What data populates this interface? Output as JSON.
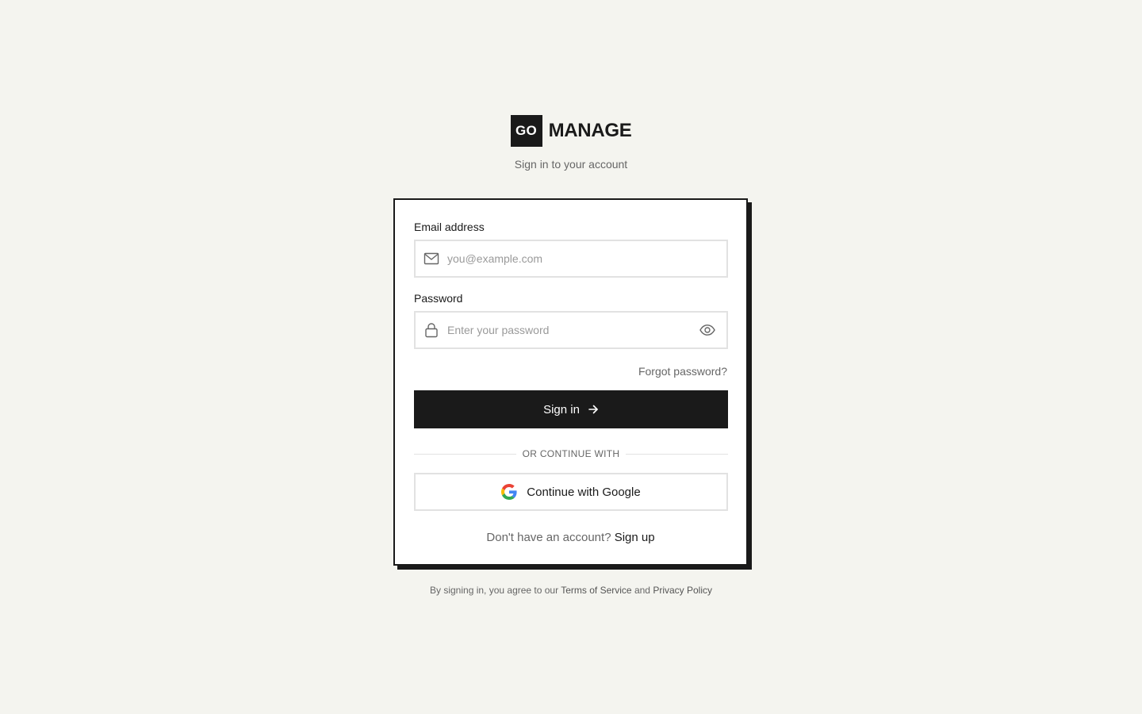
{
  "brand": {
    "logo_mark": "GO",
    "logo_text": "MANAGE",
    "subtitle": "Sign in to your account"
  },
  "form": {
    "email": {
      "label": "Email address",
      "placeholder": "you@example.com",
      "value": "",
      "icon": "mail-icon"
    },
    "password": {
      "label": "Password",
      "placeholder": "Enter your password",
      "value": "",
      "icon": "lock-icon",
      "toggle_icon": "eye-icon"
    },
    "forgot_label": "Forgot password?",
    "submit_label": "Sign in",
    "divider_label": "OR CONTINUE WITH",
    "google_label": "Continue with Google",
    "signup_prompt": "Don't have an account?",
    "signup_label": "Sign up"
  },
  "legal": {
    "prefix": "By signing in, you agree to our",
    "terms": "Terms of Service",
    "conjunction": "and",
    "privacy": "Privacy Policy"
  },
  "colors": {
    "background": "#f4f4ef",
    "primary": "#1a1a1a",
    "muted_text": "#666666",
    "border": "#e2e2e2"
  }
}
